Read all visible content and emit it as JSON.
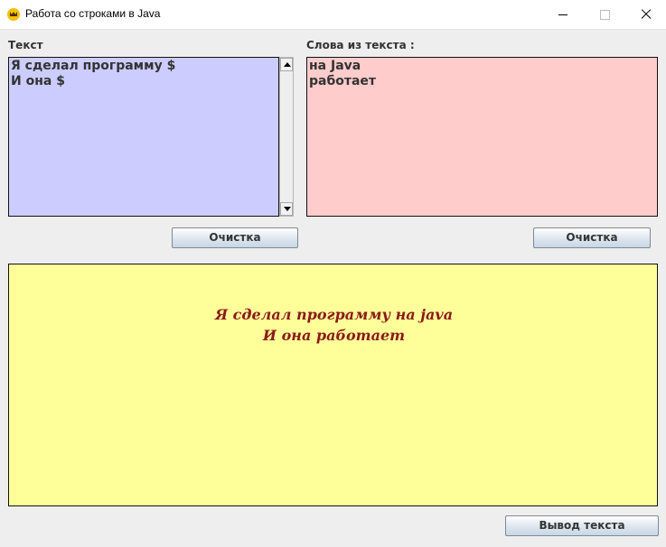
{
  "window": {
    "title": "Работа со строками в Java"
  },
  "input_panel": {
    "label": "Текст",
    "text": "Я сделал программу $\nИ она $"
  },
  "words_panel": {
    "label": "Слова из текста :",
    "text": "на Java\nработает"
  },
  "buttons": {
    "clear_left": "Очистка",
    "clear_right": "Очистка",
    "output": "Вывод текста"
  },
  "output_panel": {
    "text": "Я сделал программу на java\nИ она работает"
  },
  "colors": {
    "input_bg": "#ccccff",
    "words_bg": "#ffcccc",
    "output_bg": "#ffff99",
    "output_text": "#8b1a1a"
  },
  "icons": {
    "app": "java-crown-icon",
    "minimize": "minimize-icon",
    "maximize": "maximize-icon",
    "close": "close-icon",
    "scroll_up": "arrow-up-icon",
    "scroll_down": "arrow-down-icon"
  }
}
